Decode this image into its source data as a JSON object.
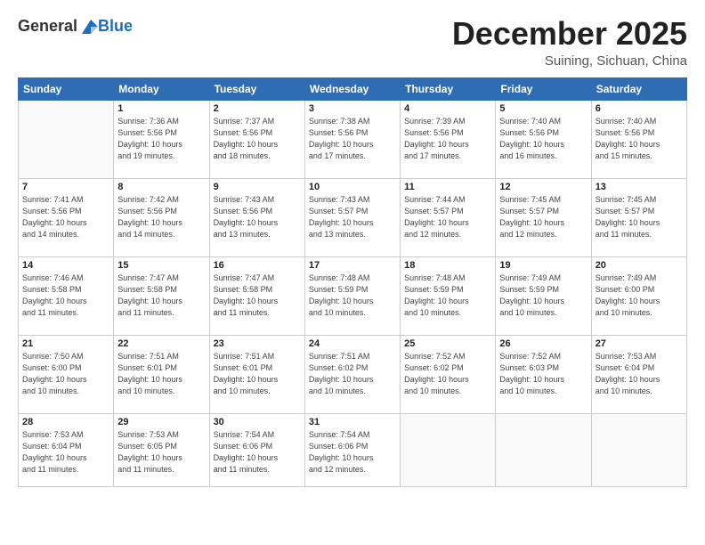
{
  "header": {
    "logo": {
      "general": "General",
      "blue": "Blue"
    },
    "title": "December 2025",
    "subtitle": "Suining, Sichuan, China"
  },
  "weekdays": [
    "Sunday",
    "Monday",
    "Tuesday",
    "Wednesday",
    "Thursday",
    "Friday",
    "Saturday"
  ],
  "weeks": [
    [
      {
        "day": "",
        "info": ""
      },
      {
        "day": "1",
        "info": "Sunrise: 7:36 AM\nSunset: 5:56 PM\nDaylight: 10 hours\nand 19 minutes."
      },
      {
        "day": "2",
        "info": "Sunrise: 7:37 AM\nSunset: 5:56 PM\nDaylight: 10 hours\nand 18 minutes."
      },
      {
        "day": "3",
        "info": "Sunrise: 7:38 AM\nSunset: 5:56 PM\nDaylight: 10 hours\nand 17 minutes."
      },
      {
        "day": "4",
        "info": "Sunrise: 7:39 AM\nSunset: 5:56 PM\nDaylight: 10 hours\nand 17 minutes."
      },
      {
        "day": "5",
        "info": "Sunrise: 7:40 AM\nSunset: 5:56 PM\nDaylight: 10 hours\nand 16 minutes."
      },
      {
        "day": "6",
        "info": "Sunrise: 7:40 AM\nSunset: 5:56 PM\nDaylight: 10 hours\nand 15 minutes."
      }
    ],
    [
      {
        "day": "7",
        "info": "Sunrise: 7:41 AM\nSunset: 5:56 PM\nDaylight: 10 hours\nand 14 minutes."
      },
      {
        "day": "8",
        "info": "Sunrise: 7:42 AM\nSunset: 5:56 PM\nDaylight: 10 hours\nand 14 minutes."
      },
      {
        "day": "9",
        "info": "Sunrise: 7:43 AM\nSunset: 5:56 PM\nDaylight: 10 hours\nand 13 minutes."
      },
      {
        "day": "10",
        "info": "Sunrise: 7:43 AM\nSunset: 5:57 PM\nDaylight: 10 hours\nand 13 minutes."
      },
      {
        "day": "11",
        "info": "Sunrise: 7:44 AM\nSunset: 5:57 PM\nDaylight: 10 hours\nand 12 minutes."
      },
      {
        "day": "12",
        "info": "Sunrise: 7:45 AM\nSunset: 5:57 PM\nDaylight: 10 hours\nand 12 minutes."
      },
      {
        "day": "13",
        "info": "Sunrise: 7:45 AM\nSunset: 5:57 PM\nDaylight: 10 hours\nand 11 minutes."
      }
    ],
    [
      {
        "day": "14",
        "info": "Sunrise: 7:46 AM\nSunset: 5:58 PM\nDaylight: 10 hours\nand 11 minutes."
      },
      {
        "day": "15",
        "info": "Sunrise: 7:47 AM\nSunset: 5:58 PM\nDaylight: 10 hours\nand 11 minutes."
      },
      {
        "day": "16",
        "info": "Sunrise: 7:47 AM\nSunset: 5:58 PM\nDaylight: 10 hours\nand 11 minutes."
      },
      {
        "day": "17",
        "info": "Sunrise: 7:48 AM\nSunset: 5:59 PM\nDaylight: 10 hours\nand 10 minutes."
      },
      {
        "day": "18",
        "info": "Sunrise: 7:48 AM\nSunset: 5:59 PM\nDaylight: 10 hours\nand 10 minutes."
      },
      {
        "day": "19",
        "info": "Sunrise: 7:49 AM\nSunset: 5:59 PM\nDaylight: 10 hours\nand 10 minutes."
      },
      {
        "day": "20",
        "info": "Sunrise: 7:49 AM\nSunset: 6:00 PM\nDaylight: 10 hours\nand 10 minutes."
      }
    ],
    [
      {
        "day": "21",
        "info": "Sunrise: 7:50 AM\nSunset: 6:00 PM\nDaylight: 10 hours\nand 10 minutes."
      },
      {
        "day": "22",
        "info": "Sunrise: 7:51 AM\nSunset: 6:01 PM\nDaylight: 10 hours\nand 10 minutes."
      },
      {
        "day": "23",
        "info": "Sunrise: 7:51 AM\nSunset: 6:01 PM\nDaylight: 10 hours\nand 10 minutes."
      },
      {
        "day": "24",
        "info": "Sunrise: 7:51 AM\nSunset: 6:02 PM\nDaylight: 10 hours\nand 10 minutes."
      },
      {
        "day": "25",
        "info": "Sunrise: 7:52 AM\nSunset: 6:02 PM\nDaylight: 10 hours\nand 10 minutes."
      },
      {
        "day": "26",
        "info": "Sunrise: 7:52 AM\nSunset: 6:03 PM\nDaylight: 10 hours\nand 10 minutes."
      },
      {
        "day": "27",
        "info": "Sunrise: 7:53 AM\nSunset: 6:04 PM\nDaylight: 10 hours\nand 10 minutes."
      }
    ],
    [
      {
        "day": "28",
        "info": "Sunrise: 7:53 AM\nSunset: 6:04 PM\nDaylight: 10 hours\nand 11 minutes."
      },
      {
        "day": "29",
        "info": "Sunrise: 7:53 AM\nSunset: 6:05 PM\nDaylight: 10 hours\nand 11 minutes."
      },
      {
        "day": "30",
        "info": "Sunrise: 7:54 AM\nSunset: 6:06 PM\nDaylight: 10 hours\nand 11 minutes."
      },
      {
        "day": "31",
        "info": "Sunrise: 7:54 AM\nSunset: 6:06 PM\nDaylight: 10 hours\nand 12 minutes."
      },
      {
        "day": "",
        "info": ""
      },
      {
        "day": "",
        "info": ""
      },
      {
        "day": "",
        "info": ""
      }
    ]
  ]
}
